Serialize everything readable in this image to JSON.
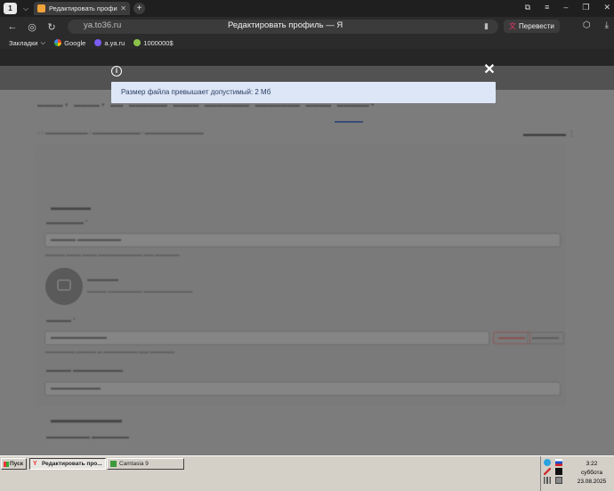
{
  "browser": {
    "tab_count": "1",
    "tab_title": "Редактировать профи",
    "url": "ya.to36.ru",
    "page_title": "Редактировать профиль — Я",
    "translate_label": "Перевести",
    "bookmarks": [
      {
        "label": "Закладки"
      },
      {
        "label": "Google"
      },
      {
        "label": "a.ya.ru"
      },
      {
        "label": "1000000$"
      }
    ]
  },
  "modal": {
    "message": "Размер файла превышает допустимый: 2 Мб",
    "close_symbol": "✕",
    "info_symbol": "i"
  },
  "taskbar": {
    "start_label": "Пуск",
    "tasks": [
      {
        "label": "Редактировать про..."
      },
      {
        "label": "Camtasia 9"
      }
    ],
    "clock": {
      "time": "3:22",
      "day": "суббота",
      "date": "23.08.2025"
    }
  },
  "colors": {
    "alert_bg": "#dce6f6",
    "alert_text": "#2c3e63",
    "overlay": "#7c7c7c"
  }
}
